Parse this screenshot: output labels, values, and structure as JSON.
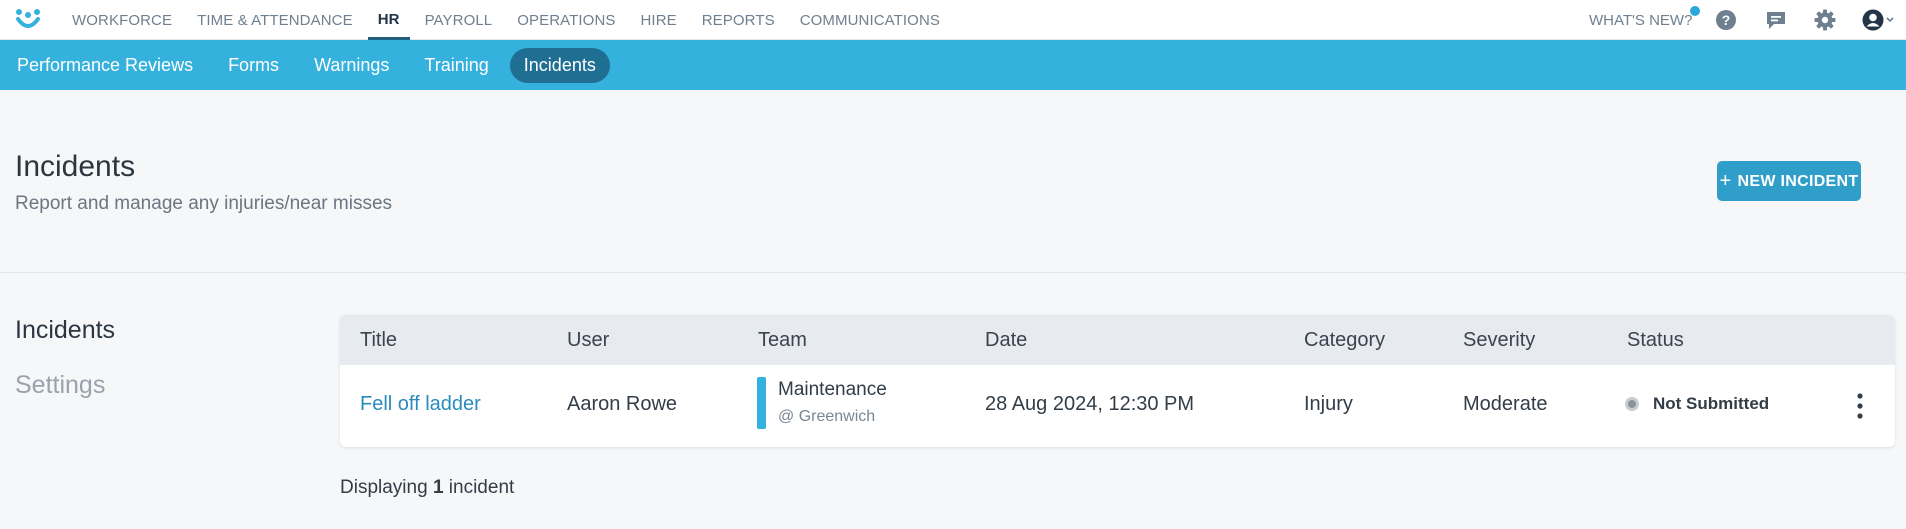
{
  "nav": {
    "items": [
      {
        "label": "WORKFORCE",
        "active": false
      },
      {
        "label": "TIME & ATTENDANCE",
        "active": false
      },
      {
        "label": "HR",
        "active": true
      },
      {
        "label": "PAYROLL",
        "active": false
      },
      {
        "label": "OPERATIONS",
        "active": false
      },
      {
        "label": "HIRE",
        "active": false
      },
      {
        "label": "REPORTS",
        "active": false
      },
      {
        "label": "COMMUNICATIONS",
        "active": false
      }
    ],
    "whats_new": "WHAT'S NEW?",
    "icons": [
      "help-icon",
      "chat-icon",
      "settings-gear-icon",
      "user-account-icon"
    ]
  },
  "subnav": {
    "items": [
      {
        "label": "Performance Reviews",
        "active": false
      },
      {
        "label": "Forms",
        "active": false
      },
      {
        "label": "Warnings",
        "active": false
      },
      {
        "label": "Training",
        "active": false
      },
      {
        "label": "Incidents",
        "active": true
      }
    ]
  },
  "header": {
    "title": "Incidents",
    "subtitle": "Report and manage any injuries/near misses",
    "new_button": "NEW INCIDENT"
  },
  "sidebar": {
    "items": [
      {
        "label": "Incidents",
        "active": true
      },
      {
        "label": "Settings",
        "active": false
      }
    ]
  },
  "table": {
    "columns": [
      "Title",
      "User",
      "Team",
      "Date",
      "Category",
      "Severity",
      "Status"
    ],
    "rows": [
      {
        "title": "Fell off ladder",
        "user": "Aaron Rowe",
        "team": "Maintenance",
        "location": "@ Greenwich",
        "date": "28 Aug 2024, 12:30 PM",
        "category": "Injury",
        "severity": "Moderate",
        "status": "Not Submitted"
      }
    ]
  },
  "footer": {
    "prefix": "Displaying",
    "count": "1",
    "suffix": "incident"
  },
  "colors": {
    "accent": "#35b1dd",
    "active_subnav": "#1f6f93",
    "button": "#2f9fc9",
    "link": "#2a8cba"
  }
}
